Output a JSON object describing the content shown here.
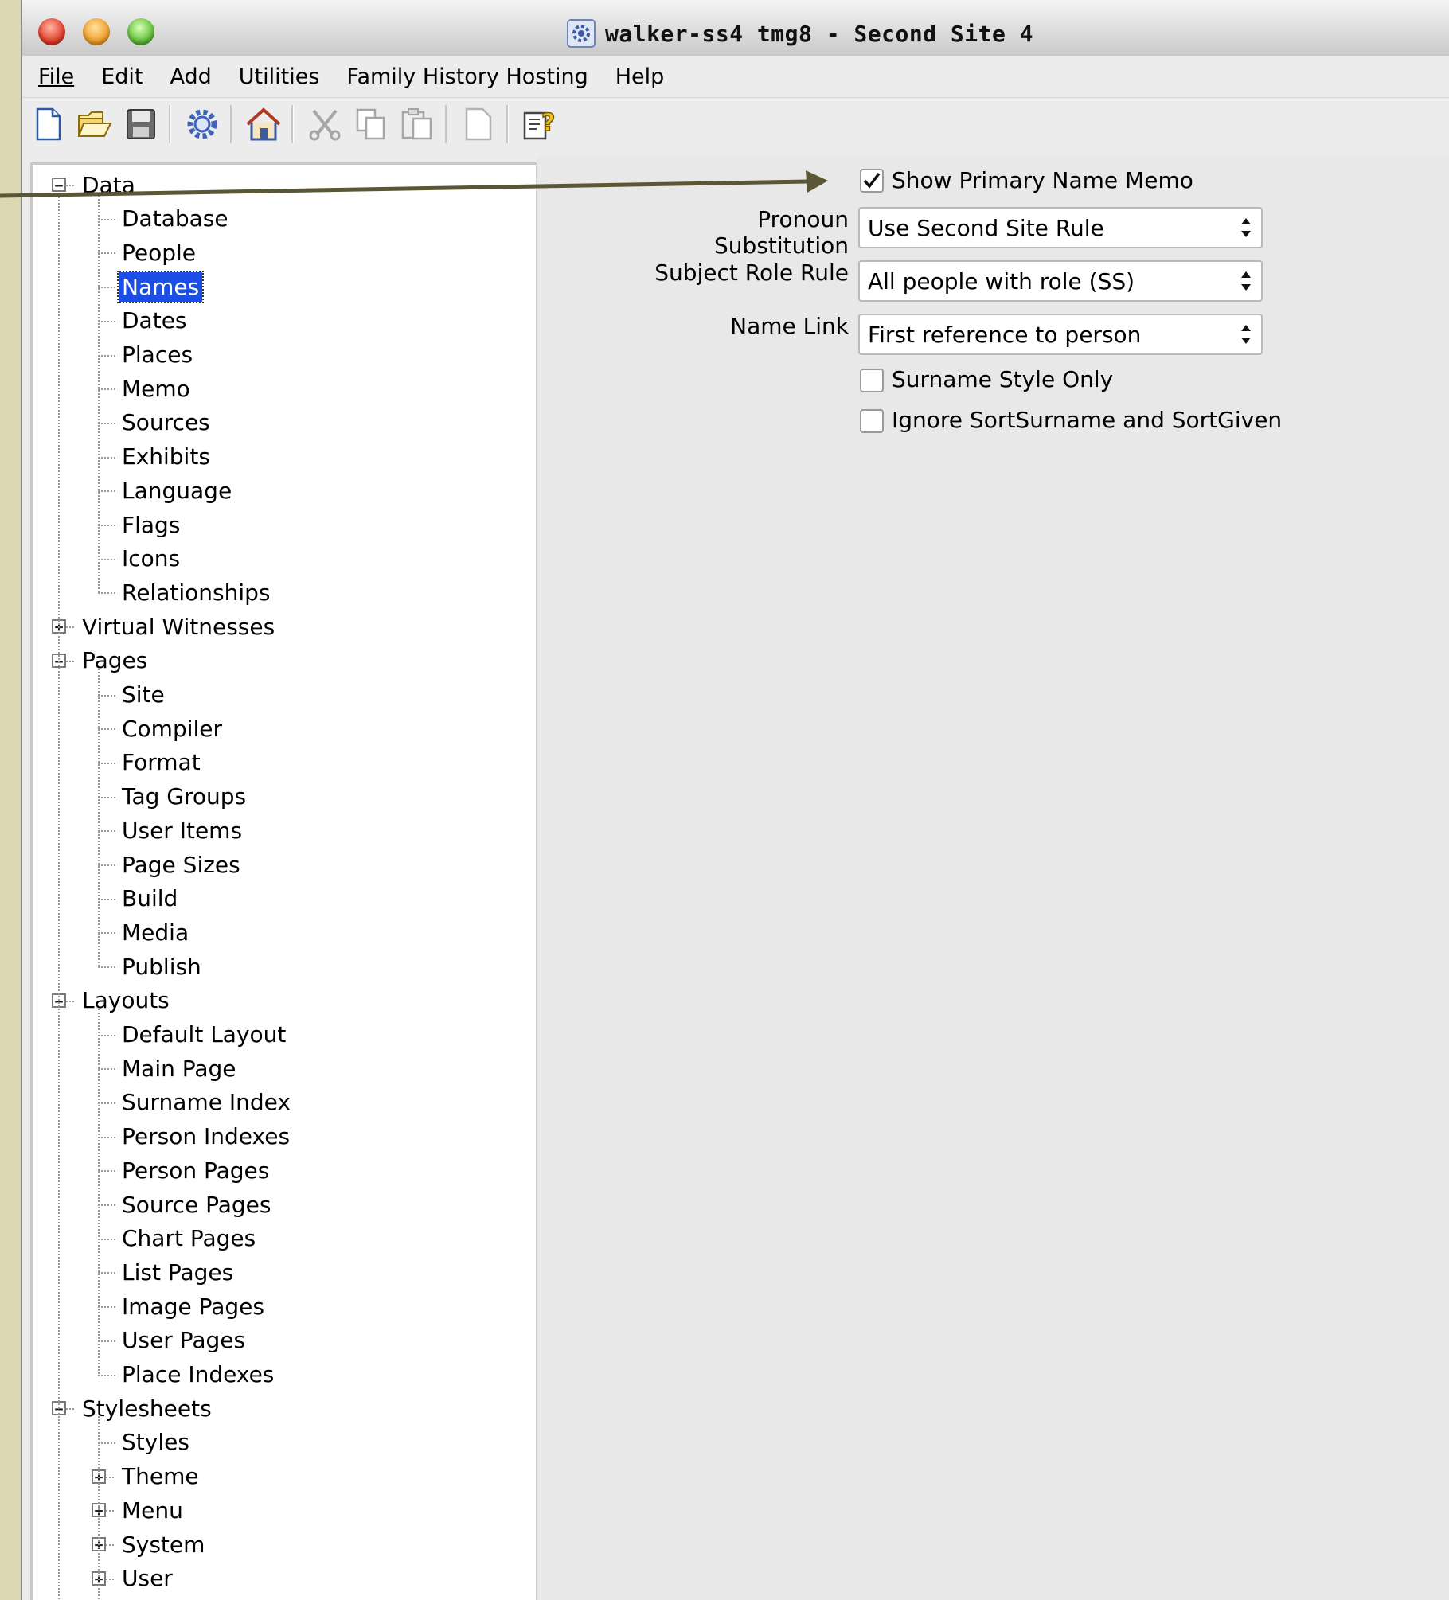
{
  "window": {
    "title": "walker-ss4 tmg8 - Second Site 4"
  },
  "menubar": [
    {
      "label": "File"
    },
    {
      "label": "Edit"
    },
    {
      "label": "Add"
    },
    {
      "label": "Utilities"
    },
    {
      "label": "Family History Hosting"
    },
    {
      "label": "Help"
    }
  ],
  "toolbar": {
    "buttons": [
      "new-file-icon",
      "open-folder-icon",
      "save-disk-icon",
      "settings-gear-icon",
      "home-icon",
      "cut-scissors-icon",
      "copy-icon",
      "paste-icon",
      "blank-page-icon",
      "help-icon"
    ]
  },
  "tree": {
    "data": "Data",
    "data_children": [
      "Database",
      "People",
      "Names",
      "Dates",
      "Places",
      "Memo",
      "Sources",
      "Exhibits",
      "Language",
      "Flags",
      "Icons",
      "Relationships"
    ],
    "virtual_witnesses": "Virtual Witnesses",
    "pages": "Pages",
    "pages_children": [
      "Site",
      "Compiler",
      "Format",
      "Tag Groups",
      "User Items",
      "Page Sizes",
      "Build",
      "Media",
      "Publish"
    ],
    "layouts": "Layouts",
    "layouts_children": [
      "Default Layout",
      "Main Page",
      "Surname Index",
      "Person Indexes",
      "Person Pages",
      "Source Pages",
      "Chart Pages",
      "List Pages",
      "Image Pages",
      "User Pages",
      "Place Indexes"
    ],
    "stylesheets": "Stylesheets",
    "styles": "Styles",
    "stylesheet_groups": [
      "Theme",
      "Menu",
      "System",
      "User"
    ],
    "selected": "Names"
  },
  "form": {
    "show_primary_name_memo": {
      "label": "Show Primary Name Memo",
      "checked": true
    },
    "pronoun_substitution": {
      "label": "Pronoun Substitution",
      "value": "Use Second Site Rule"
    },
    "subject_role_rule": {
      "label": "Subject Role Rule",
      "value": "All people with role (SS)"
    },
    "name_link": {
      "label": "Name Link",
      "value": "First reference to person"
    },
    "surname_style_only": {
      "label": "Surname Style Only",
      "checked": false
    },
    "ignore_sort": {
      "label": "Ignore SortSurname and SortGiven",
      "checked": false
    }
  },
  "colors": {
    "selection": "#1a4ee6",
    "annotation_arrow": "#5b5636",
    "background": "#ddd8b2"
  }
}
